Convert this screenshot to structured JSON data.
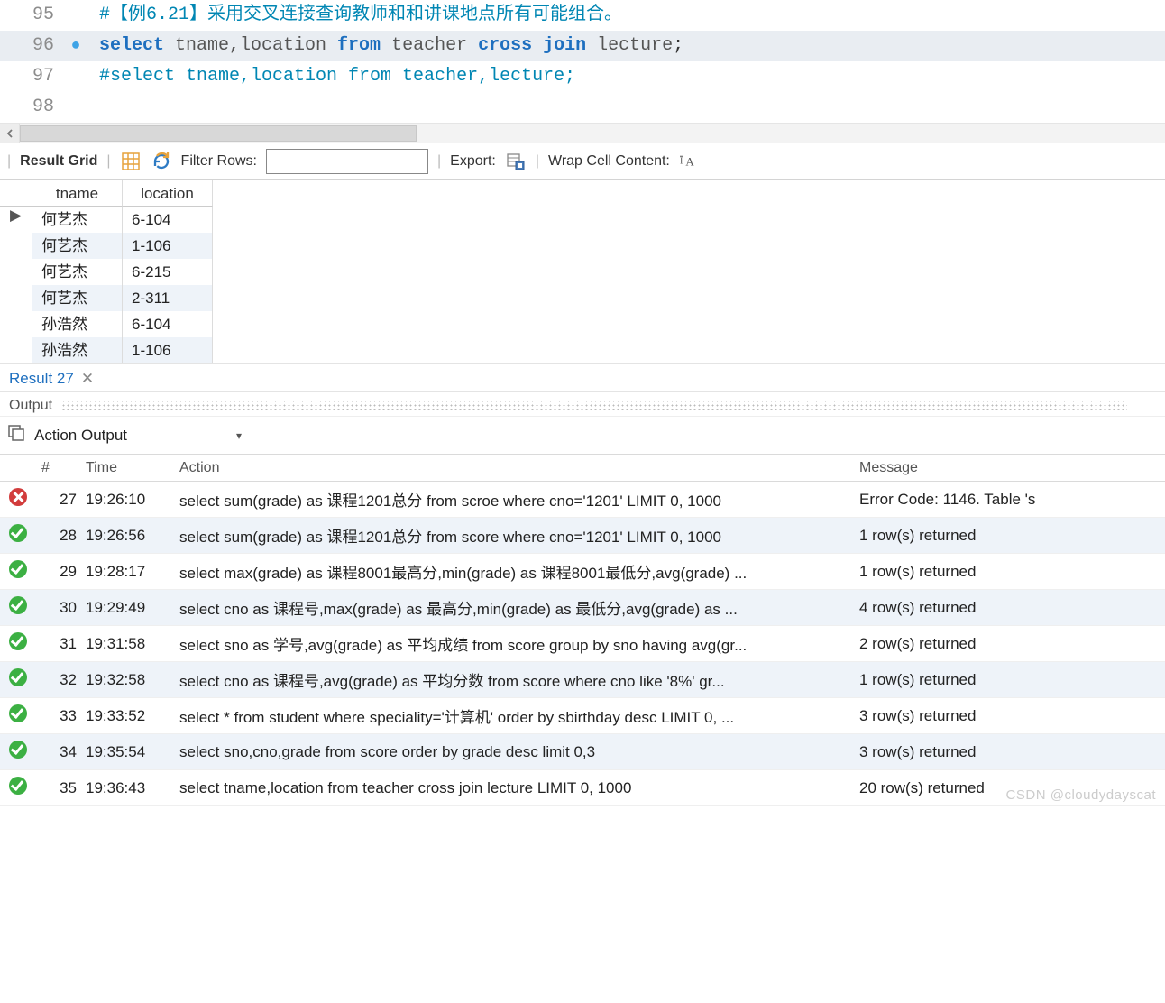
{
  "editor": {
    "lines": [
      {
        "num": "95",
        "marker": "",
        "active": false
      },
      {
        "num": "96",
        "marker": "●",
        "active": true
      },
      {
        "num": "97",
        "marker": "",
        "active": false
      },
      {
        "num": "98",
        "marker": "",
        "active": false
      }
    ],
    "line95_comment": "#【例6.21】采用交叉连接查询教师和和讲课地点所有可能组合。",
    "line96": {
      "kw_select": "select",
      "cols": " tname,location ",
      "kw_from": "from",
      "t1": " teacher ",
      "kw_cross": "cross",
      "sp1": " ",
      "kw_join": "join",
      "t2": " lecture",
      "semi": ";"
    },
    "line97_comment": "#select tname,location from teacher,lecture;"
  },
  "result_toolbar": {
    "label": "Result Grid",
    "filter_label": "Filter Rows:",
    "filter_value": "",
    "export_label": "Export:",
    "wrap_label": "Wrap Cell Content:"
  },
  "grid": {
    "headers": {
      "c1": "tname",
      "c2": "location"
    },
    "rows": [
      {
        "sel": "▶",
        "tname": "何艺杰",
        "location": "6-104"
      },
      {
        "sel": "",
        "tname": "何艺杰",
        "location": "1-106"
      },
      {
        "sel": "",
        "tname": "何艺杰",
        "location": "6-215"
      },
      {
        "sel": "",
        "tname": "何艺杰",
        "location": "2-311"
      },
      {
        "sel": "",
        "tname": "孙浩然",
        "location": "6-104"
      },
      {
        "sel": "",
        "tname": "孙浩然",
        "location": "1-106"
      }
    ]
  },
  "result_tab": {
    "label": "Result 27",
    "close": "✕"
  },
  "output": {
    "title": "Output",
    "dropdown": "Action Output",
    "headers": {
      "num": "#",
      "time": "Time",
      "action": "Action",
      "message": "Message"
    },
    "rows": [
      {
        "status": "err",
        "num": "27",
        "time": "19:26:10",
        "action": "select sum(grade) as 课程1201总分 from scroe where cno='1201' LIMIT 0, 1000",
        "message": "Error Code: 1146. Table 's"
      },
      {
        "status": "ok",
        "num": "28",
        "time": "19:26:56",
        "action": "select sum(grade) as 课程1201总分 from score where cno='1201' LIMIT 0, 1000",
        "message": "1 row(s) returned"
      },
      {
        "status": "ok",
        "num": "29",
        "time": "19:28:17",
        "action": "select max(grade) as 课程8001最高分,min(grade) as 课程8001最低分,avg(grade) ...",
        "message": "1 row(s) returned"
      },
      {
        "status": "ok",
        "num": "30",
        "time": "19:29:49",
        "action": "select cno as 课程号,max(grade) as 最高分,min(grade) as 最低分,avg(grade) as ...",
        "message": "4 row(s) returned"
      },
      {
        "status": "ok",
        "num": "31",
        "time": "19:31:58",
        "action": "select sno as 学号,avg(grade) as 平均成绩 from score group by sno having avg(gr...",
        "message": "2 row(s) returned"
      },
      {
        "status": "ok",
        "num": "32",
        "time": "19:32:58",
        "action": "select cno as 课程号,avg(grade) as 平均分数 from score where cno like '8%'    gr...",
        "message": "1 row(s) returned"
      },
      {
        "status": "ok",
        "num": "33",
        "time": "19:33:52",
        "action": "select * from student where speciality='计算机'    order by sbirthday desc LIMIT 0, ...",
        "message": "3 row(s) returned"
      },
      {
        "status": "ok",
        "num": "34",
        "time": "19:35:54",
        "action": "select sno,cno,grade from score order by grade desc    limit 0,3",
        "message": "3 row(s) returned"
      },
      {
        "status": "ok",
        "num": "35",
        "time": "19:36:43",
        "action": "select tname,location from teacher cross join lecture LIMIT 0, 1000",
        "message": "20 row(s) returned"
      }
    ]
  },
  "watermark": "CSDN @cloudydayscat",
  "colors": {
    "keyword": "#1E6FBF",
    "comment": "#0086B3",
    "row_alt": "#EEF3F9",
    "ok": "#3CB043",
    "err": "#D23C3C"
  }
}
